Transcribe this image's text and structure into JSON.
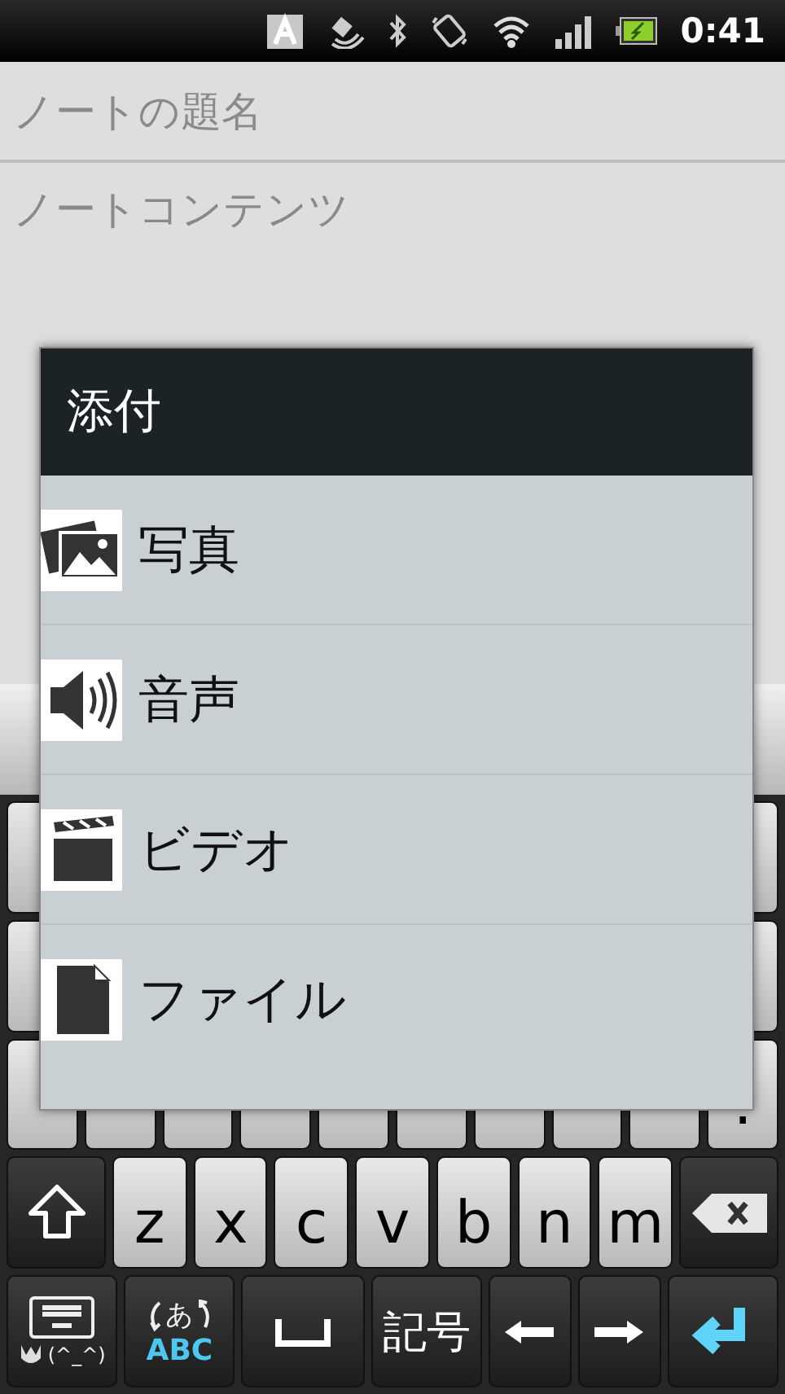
{
  "status_bar": {
    "time": "0:41"
  },
  "note": {
    "title_placeholder": "ノートの題名",
    "content_placeholder": "ノートコンテンツ"
  },
  "keyboard": {
    "rows": [
      {
        "keys": [
          {
            "kind": "blank"
          },
          {
            "kind": "blank"
          }
        ]
      },
      {
        "keys": [
          {
            "kind": "blank"
          },
          {
            "kind": "blank"
          }
        ]
      },
      {
        "keys": [
          {
            "kind": "blank"
          },
          {
            "kind": "blank"
          },
          {
            "kind": "blank"
          },
          {
            "kind": "blank"
          },
          {
            "kind": "blank"
          },
          {
            "kind": "blank"
          },
          {
            "kind": "blank"
          },
          {
            "kind": "blank"
          },
          {
            "kind": "blank"
          },
          {
            "kind": "letter",
            "label": "."
          }
        ]
      },
      {
        "keys": [
          {
            "kind": "shift"
          },
          {
            "kind": "letter",
            "label": "z"
          },
          {
            "kind": "letter",
            "label": "x"
          },
          {
            "kind": "letter",
            "label": "c"
          },
          {
            "kind": "letter",
            "label": "v"
          },
          {
            "kind": "letter",
            "label": "b"
          },
          {
            "kind": "letter",
            "label": "n"
          },
          {
            "kind": "letter",
            "label": "m"
          },
          {
            "kind": "backspace"
          }
        ]
      },
      {
        "keys": [
          {
            "kind": "settings",
            "label": "(^_^)"
          },
          {
            "kind": "mode",
            "label": "あ",
            "sublabel": "ABC"
          },
          {
            "kind": "space"
          },
          {
            "kind": "symbol",
            "label": "記号"
          },
          {
            "kind": "left"
          },
          {
            "kind": "right"
          },
          {
            "kind": "enter"
          }
        ]
      }
    ]
  },
  "dialog": {
    "title": "添付",
    "items": [
      {
        "kind": "photo",
        "label": "写真"
      },
      {
        "kind": "audio",
        "label": "音声"
      },
      {
        "kind": "video",
        "label": "ビデオ"
      },
      {
        "kind": "file",
        "label": "ファイル"
      }
    ]
  }
}
